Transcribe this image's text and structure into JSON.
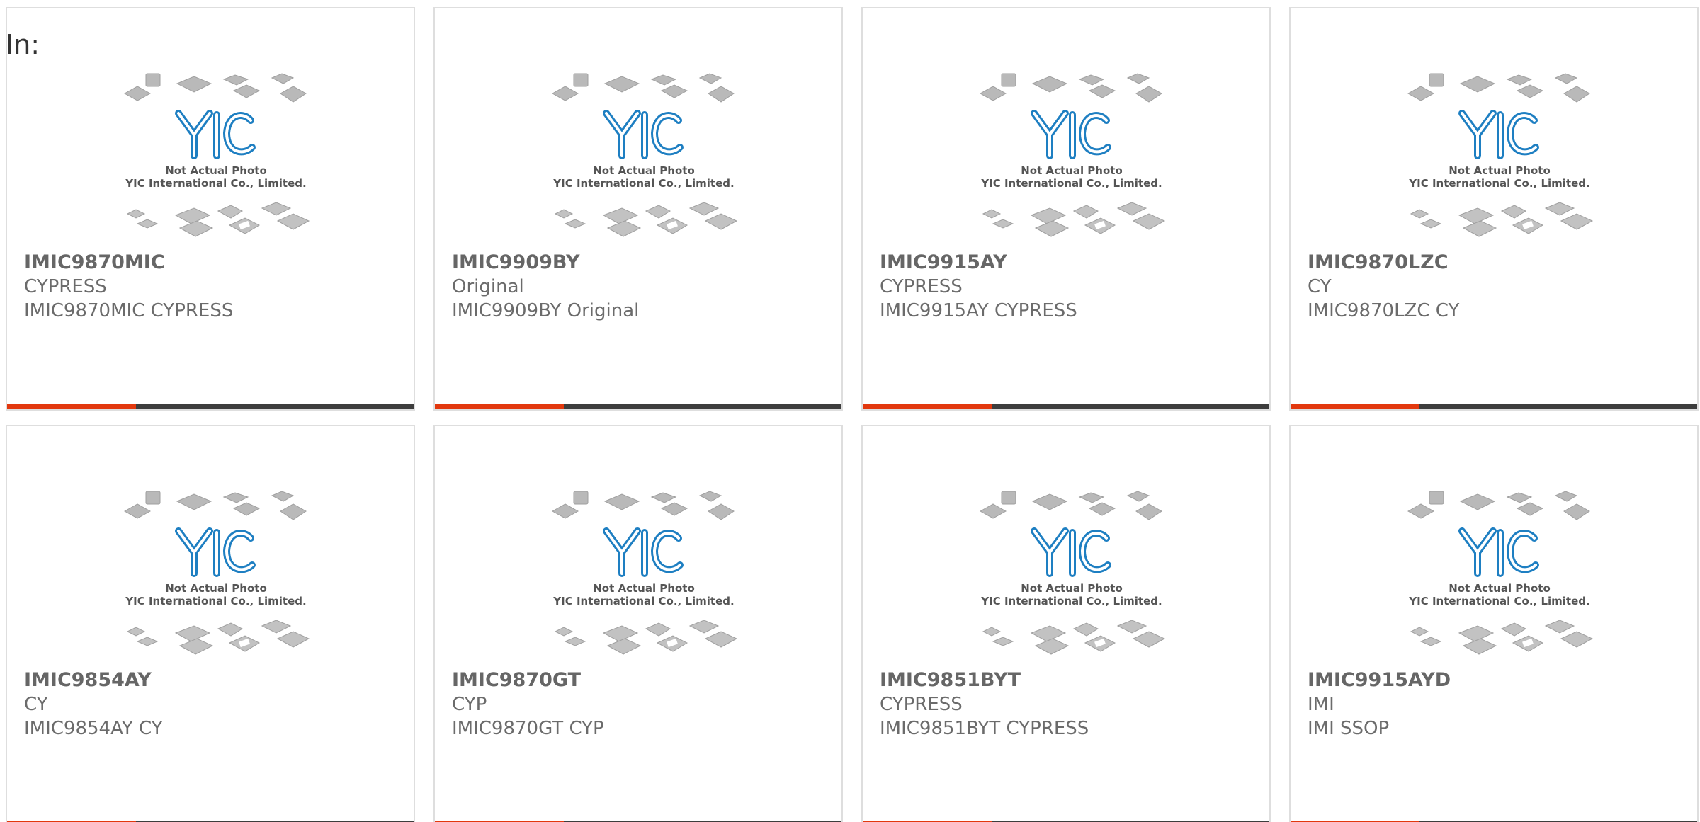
{
  "heading": "In:",
  "watermark": {
    "line1": "Not Actual Photo",
    "line2": "YIC International Co., Limited.",
    "logo_text": "YIC"
  },
  "colors": {
    "accent": "#e2380e",
    "bar": "#3d3d3d",
    "logo": "#1e7fc2"
  },
  "products": [
    {
      "part": "IMIC9870MIC",
      "manufacturer": "CYPRESS",
      "desc": "IMIC9870MIC CYPRESS"
    },
    {
      "part": "IMIC9909BY",
      "manufacturer": "Original",
      "desc": "IMIC9909BY Original"
    },
    {
      "part": "IMIC9915AY",
      "manufacturer": "CYPRESS",
      "desc": "IMIC9915AY CYPRESS"
    },
    {
      "part": "IMIC9870LZC",
      "manufacturer": "CY",
      "desc": "IMIC9870LZC CY"
    },
    {
      "part": "IMIC9854AY",
      "manufacturer": "CY",
      "desc": "IMIC9854AY CY"
    },
    {
      "part": "IMIC9870GT",
      "manufacturer": "CYP",
      "desc": "IMIC9870GT CYP"
    },
    {
      "part": "IMIC9851BYT",
      "manufacturer": "CYPRESS",
      "desc": "IMIC9851BYT CYPRESS"
    },
    {
      "part": "IMIC9915AYD",
      "manufacturer": "IMI",
      "desc": "IMI SSOP"
    }
  ]
}
